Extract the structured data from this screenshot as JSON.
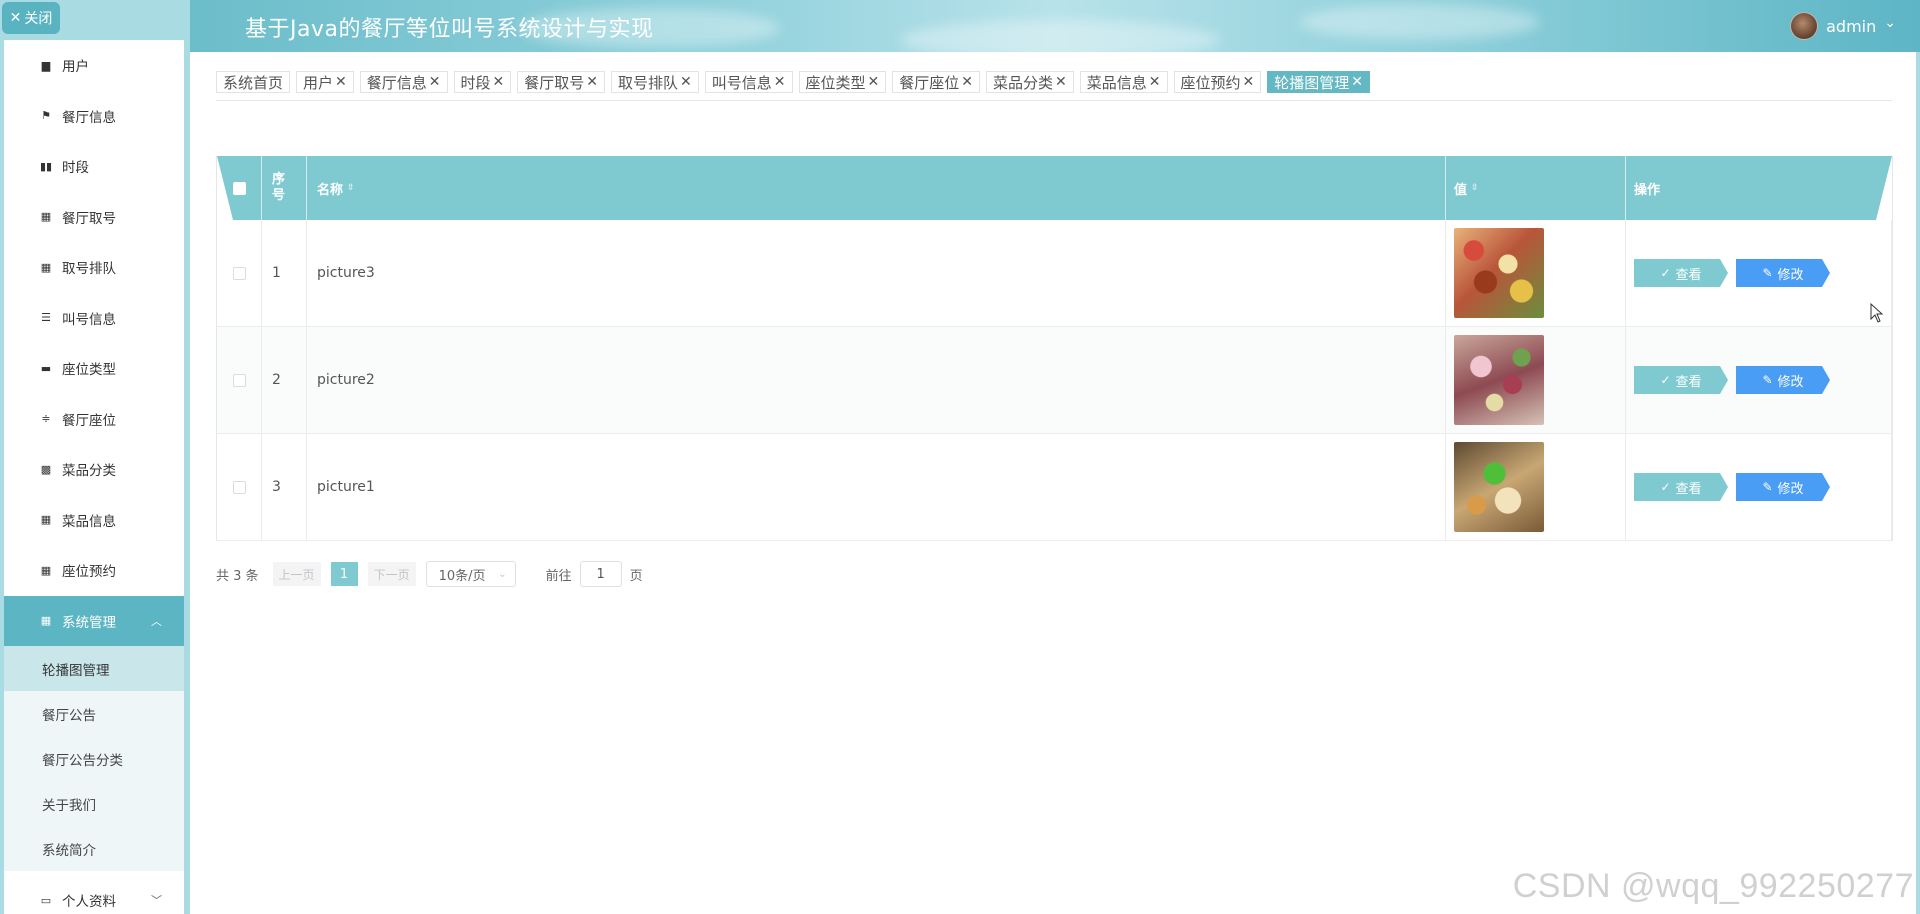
{
  "header": {
    "title": "基于Java的餐厅等位叫号系统设计与实现",
    "user_name": "admin",
    "user_caret": "⌄"
  },
  "sidebar": {
    "close_label": "关闭",
    "items": [
      {
        "label": "用户",
        "icon": "user-icon"
      },
      {
        "label": "餐厅信息",
        "icon": "flag-icon"
      },
      {
        "label": "时段",
        "icon": "bar-chart-icon"
      },
      {
        "label": "餐厅取号",
        "icon": "grid-icon"
      },
      {
        "label": "取号排队",
        "icon": "grid-icon"
      },
      {
        "label": "叫号信息",
        "icon": "list-icon"
      },
      {
        "label": "座位类型",
        "icon": "comment-icon"
      },
      {
        "label": "餐厅座位",
        "icon": "sliders-icon"
      },
      {
        "label": "菜品分类",
        "icon": "apps-icon"
      },
      {
        "label": "菜品信息",
        "icon": "grid-icon"
      },
      {
        "label": "座位预约",
        "icon": "grid-icon"
      }
    ],
    "system_group": {
      "label": "系统管理",
      "icon": "grid-icon",
      "sub_items": [
        "轮播图管理",
        "餐厅公告",
        "餐厅公告分类",
        "关于我们",
        "系统简介"
      ]
    },
    "profile": {
      "label": "个人资料",
      "icon": "profile-icon"
    }
  },
  "tabs": [
    {
      "label": "系统首页",
      "closable": false
    },
    {
      "label": "用户",
      "closable": true
    },
    {
      "label": "餐厅信息",
      "closable": true
    },
    {
      "label": "时段",
      "closable": true
    },
    {
      "label": "餐厅取号",
      "closable": true
    },
    {
      "label": "取号排队",
      "closable": true
    },
    {
      "label": "叫号信息",
      "closable": true
    },
    {
      "label": "座位类型",
      "closable": true
    },
    {
      "label": "餐厅座位",
      "closable": true
    },
    {
      "label": "菜品分类",
      "closable": true
    },
    {
      "label": "菜品信息",
      "closable": true
    },
    {
      "label": "座位预约",
      "closable": true
    },
    {
      "label": "轮播图管理",
      "closable": true,
      "active": true
    }
  ],
  "table": {
    "headers": {
      "index_line1": "序",
      "index_line2": "号",
      "name": "名称",
      "value": "值",
      "operation": "操作"
    },
    "rows": [
      {
        "index": "1",
        "name": "picture3",
        "image": "food-photo-1"
      },
      {
        "index": "2",
        "name": "picture2",
        "image": "food-photo-2"
      },
      {
        "index": "3",
        "name": "picture1",
        "image": "food-photo-3"
      }
    ],
    "view_label": "查看",
    "edit_label": "修改"
  },
  "pagination": {
    "total": "共 3 条",
    "prev": "上一页",
    "next": "下一页",
    "current_page": "1",
    "page_size": "10条/页",
    "goto_label": "前往",
    "goto_value": "1",
    "page_unit": "页"
  },
  "watermark": "CSDN @wqq_992250277",
  "colors": {
    "accent": "#7fcad0",
    "sidebar_active": "#5cb5c3",
    "edit_button": "#4a9df5"
  }
}
